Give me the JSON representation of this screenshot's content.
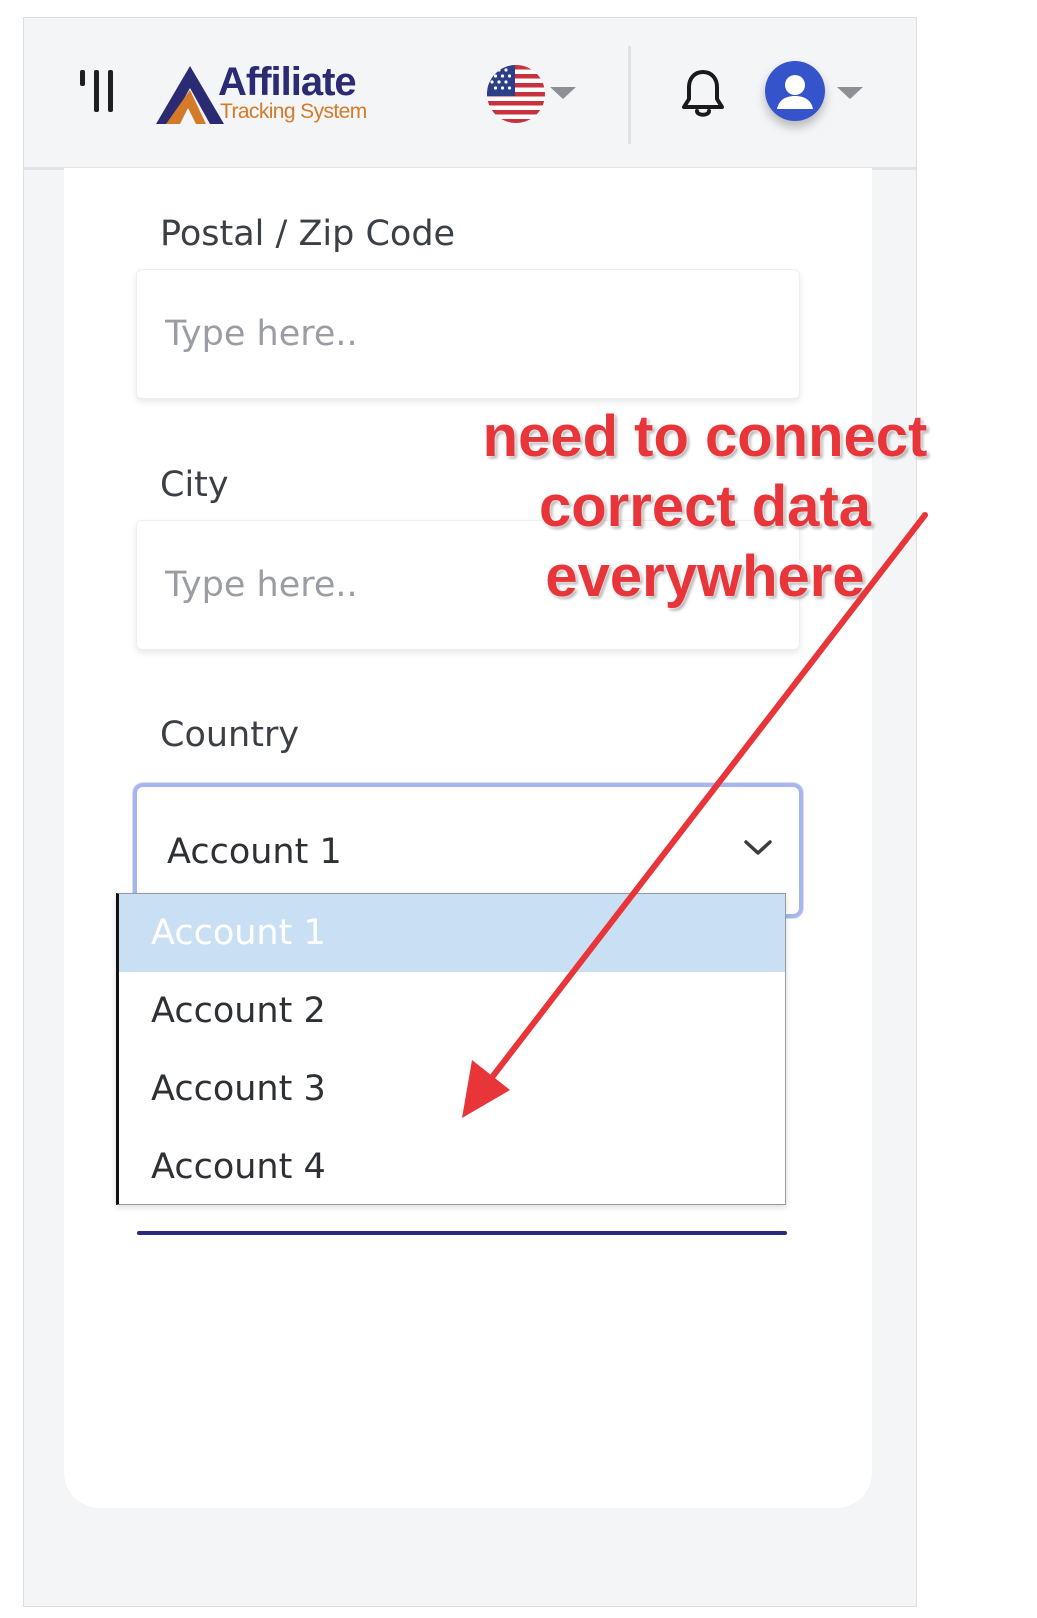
{
  "header": {
    "logo_title": "Affiliate",
    "logo_subtitle": "Tracking System"
  },
  "form": {
    "postal_label": "Postal / Zip Code",
    "postal_placeholder": "Type here..",
    "city_label": "City",
    "city_placeholder": "Type here..",
    "country_label": "Country",
    "country_selected": "Account 1",
    "country_options": [
      "Account 1",
      "Account 2",
      "Account 3",
      "Account 4"
    ]
  },
  "annotation": {
    "lines": [
      "need to connect",
      "correct data",
      "everywhere"
    ],
    "color": "#e8353a"
  },
  "colors": {
    "brand_navy": "#2a2b73",
    "brand_orange": "#d57a2a",
    "selected_option": "#c9e0f4",
    "focus_border": "#a8b6ee"
  },
  "icons": [
    "menu-icon",
    "us-flag-icon",
    "chevron-down-icon",
    "bell-icon",
    "user-avatar-icon"
  ]
}
